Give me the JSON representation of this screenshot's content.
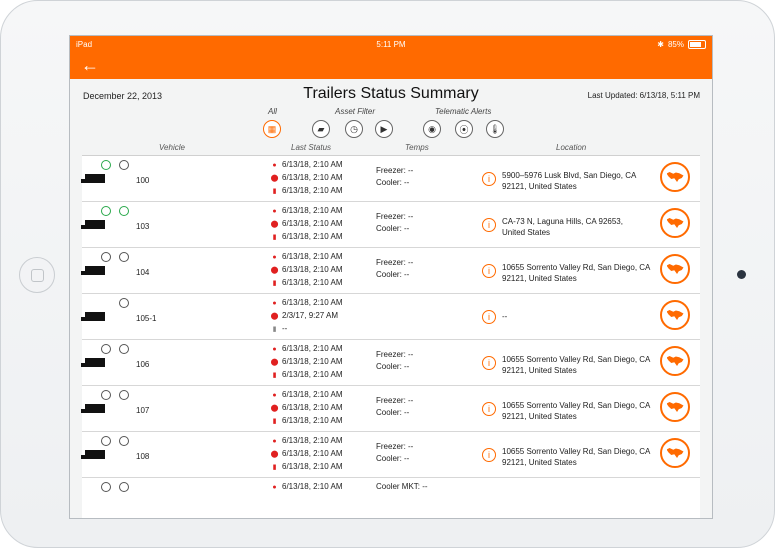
{
  "status_bar": {
    "device": "iPad",
    "time": "5:11 PM",
    "battery": "85%"
  },
  "nav": {
    "back_label": "←"
  },
  "header": {
    "date": "December 22, 2013",
    "title": "Trailers Status Summary",
    "last_updated": "Last Updated: 6/13/18, 5:11 PM"
  },
  "filters": {
    "all_label": "All",
    "asset_filter_label": "Asset Filter",
    "telematic_alerts_label": "Telematic Alerts"
  },
  "columns": {
    "vehicle": "Vehicle",
    "last_status": "Last Status",
    "temps": "Temps",
    "location": "Location"
  },
  "rows": [
    {
      "vehicle": "100",
      "ls1": "6/13/18, 2:10 AM",
      "ls2": "6/13/18, 2:10 AM",
      "ls3": "6/13/18, 2:10 AM",
      "freezer": "Freezer: --",
      "cooler": "Cooler: --",
      "loc1": "5900–5976 Lusk Blvd, San Diego, CA",
      "loc2": "92121, United States"
    },
    {
      "vehicle": "103",
      "ls1": "6/13/18, 2:10 AM",
      "ls2": "6/13/18, 2:10 AM",
      "ls3": "6/13/18, 2:10 AM",
      "freezer": "Freezer: --",
      "cooler": "Cooler: --",
      "loc1": "CA-73 N, Laguna Hills, CA  92653,",
      "loc2": "United States"
    },
    {
      "vehicle": "104",
      "ls1": "6/13/18, 2:10 AM",
      "ls2": "6/13/18, 2:10 AM",
      "ls3": "6/13/18, 2:10 AM",
      "freezer": "Freezer: --",
      "cooler": "Cooler: --",
      "loc1": "10655 Sorrento Valley Rd, San Diego, CA",
      "loc2": "92121, United States"
    },
    {
      "vehicle": "105-1",
      "ls1": "6/13/18, 2:10 AM",
      "ls2": "2/3/17, 9:27 AM",
      "ls3": "--",
      "freezer": "",
      "cooler": "",
      "loc1": "--",
      "loc2": ""
    },
    {
      "vehicle": "106",
      "ls1": "6/13/18, 2:10 AM",
      "ls2": "6/13/18, 2:10 AM",
      "ls3": "6/13/18, 2:10 AM",
      "freezer": "Freezer: --",
      "cooler": "Cooler: --",
      "loc1": "10655 Sorrento Valley Rd, San Diego, CA",
      "loc2": "92121, United States"
    },
    {
      "vehicle": "107",
      "ls1": "6/13/18, 2:10 AM",
      "ls2": "6/13/18, 2:10 AM",
      "ls3": "6/13/18, 2:10 AM",
      "freezer": "Freezer: --",
      "cooler": "Cooler: --",
      "loc1": "10655 Sorrento Valley Rd, San Diego, CA",
      "loc2": "92121, United States"
    },
    {
      "vehicle": "108",
      "ls1": "6/13/18, 2:10 AM",
      "ls2": "6/13/18, 2:10 AM",
      "ls3": "6/13/18, 2:10 AM",
      "freezer": "Freezer: --",
      "cooler": "Cooler: --",
      "loc1": "10655 Sorrento Valley Rd, San Diego, CA",
      "loc2": "92121, United States"
    },
    {
      "vehicle": "",
      "ls1": "6/13/18, 2:10 AM",
      "ls2": "",
      "ls3": "",
      "freezer": "Cooler  MKT: --",
      "cooler": "",
      "loc1": "",
      "loc2": ""
    }
  ],
  "colors": {
    "accent": "#ff6a00",
    "alert": "#e02020",
    "ok": "#29a84a"
  }
}
